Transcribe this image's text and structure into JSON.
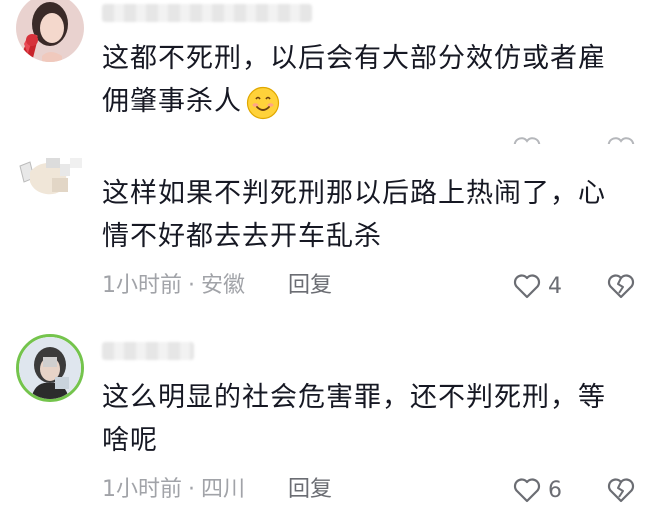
{
  "comments": [
    {
      "text_line1": "这都不死刑，以后会有大部分效仿或者雇",
      "text_line2": "佣肇事杀人",
      "emoji": "smiling-face"
    },
    {
      "text_line1": "这样如果不判死刑那以后路上热闹了，心",
      "text_line2": "情不好都去去开车乱杀",
      "time": "1小时前",
      "location": "安徽",
      "reply_label": "回复",
      "likes": "4"
    },
    {
      "text_line1": "这么明显的社会危害罪，还不判死刑，等",
      "text_line2": "啥呢",
      "time": "1小时前",
      "location": "四川",
      "reply_label": "回复",
      "likes": "6"
    }
  ],
  "colors": {
    "text": "#161823",
    "meta": "#a1a3a8",
    "action": "#6b6d73",
    "avatar_ring": "#74c44c"
  },
  "meta_separator": "·"
}
